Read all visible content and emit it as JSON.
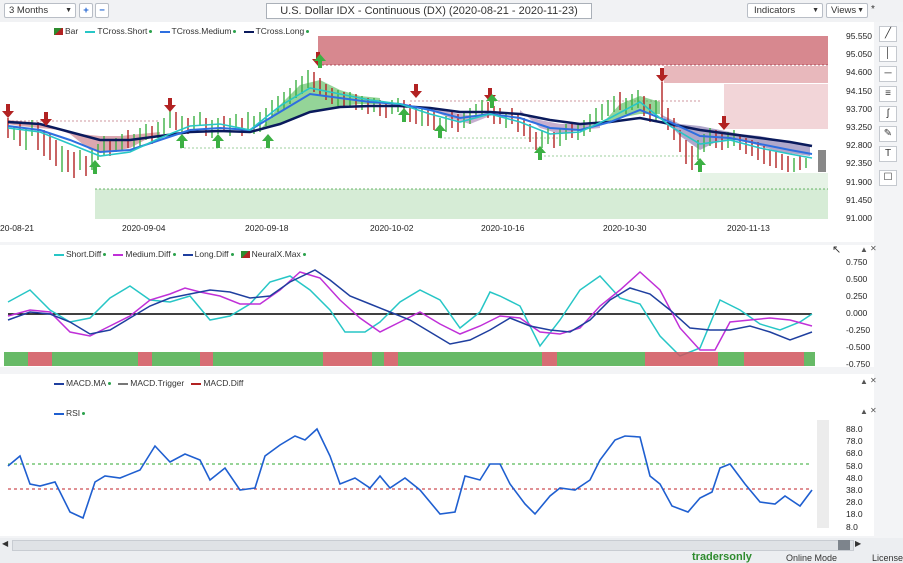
{
  "toolbar": {
    "period": "3 Months",
    "add_icon": "plus-icon",
    "remove_icon": "minus-icon",
    "title": "U.S. Dollar IDX - Continuous (DX) (2020-08-21 - 2020-11-23)",
    "indicators_label": "Indicators",
    "views_label": "Views",
    "pin_label": "*"
  },
  "price_panel": {
    "legend": [
      {
        "label": "Bar",
        "color": "#2e8b2e"
      },
      {
        "label": "TCross.Short",
        "color": "#27c6c6"
      },
      {
        "label": "TCross.Medium",
        "color": "#2e6fe0"
      },
      {
        "label": "TCross.Long",
        "color": "#0a1a5c"
      }
    ],
    "y_ticks": [
      "95.550",
      "95.050",
      "94.600",
      "94.150",
      "93.700",
      "93.250",
      "92.800",
      "92.350",
      "91.900",
      "91.450",
      "91.000"
    ],
    "x_ticks": [
      "20-08-21",
      "2020-09-04",
      "2020-09-18",
      "2020-10-02",
      "2020-10-16",
      "2020-10-30",
      "2020-11-13"
    ]
  },
  "diff_panel": {
    "legend": [
      {
        "label": "Short.Diff",
        "color": "#27c6c6"
      },
      {
        "label": "Medium.Diff",
        "color": "#c030d8"
      },
      {
        "label": "Long.Diff",
        "color": "#1f3f9f"
      },
      {
        "label": "NeuralX.Max",
        "color": "#2e8b2e"
      }
    ],
    "y_ticks": [
      "0.750",
      "0.500",
      "0.250",
      "0.000",
      "-0.250",
      "-0.500",
      "-0.750"
    ]
  },
  "macd_panel": {
    "legend": [
      {
        "label": "MACD.MA",
        "color": "#1f3f9f"
      },
      {
        "label": "MACD.Trigger",
        "color": "#777777"
      },
      {
        "label": "MACD.Diff",
        "color": "#b22222"
      }
    ]
  },
  "rsi_panel": {
    "legend": [
      {
        "label": "RSI",
        "color": "#1f5fd0"
      }
    ],
    "y_ticks": [
      "88.0",
      "78.0",
      "68.0",
      "58.0",
      "48.0",
      "38.0",
      "28.0",
      "18.0",
      "8.0"
    ]
  },
  "tools": [
    "draw-line-icon",
    "vertical-line-icon",
    "horizontal-line-icon",
    "fib-retracement-icon",
    "pattern-tool-icon",
    "annotate-icon",
    "comment-icon"
  ],
  "status": {
    "brand": "tradersonly",
    "mode": "Online Mode",
    "license": "License"
  },
  "colors": {
    "bull": "#3cb043",
    "bear": "#b22222",
    "resistance_zone": "#c9606a",
    "support_zone": "#8fd08f"
  }
}
